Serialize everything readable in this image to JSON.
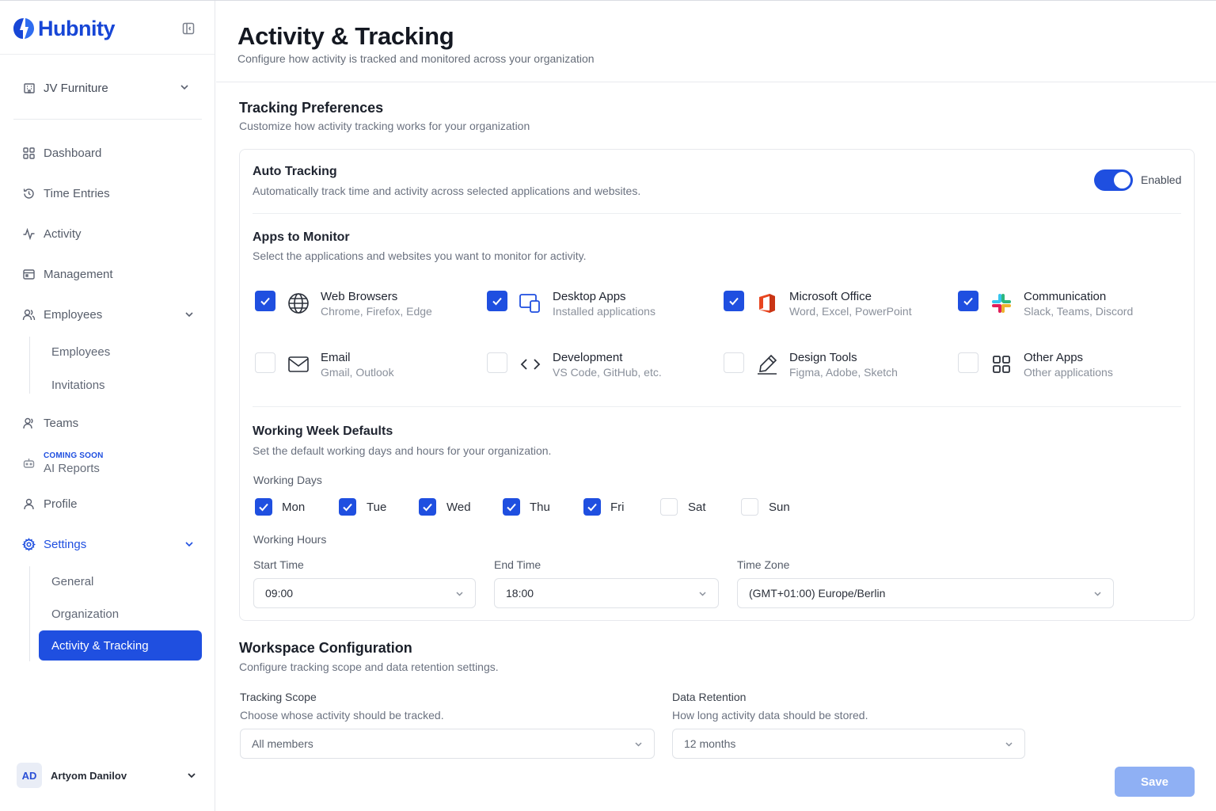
{
  "brand": {
    "name": "Hubnity"
  },
  "org": {
    "name": "JV Furniture"
  },
  "nav": {
    "dashboard": "Dashboard",
    "time_entries": "Time Entries",
    "activity": "Activity",
    "management": "Management",
    "employees": "Employees",
    "employees_sub": [
      "Employees",
      "Invitations"
    ],
    "teams": "Teams",
    "ai_badge": "COMING SOON",
    "ai_reports": "AI Reports",
    "profile": "Profile",
    "settings": "Settings",
    "settings_sub": [
      "General",
      "Organization",
      "Activity & Tracking"
    ]
  },
  "user": {
    "initials": "AD",
    "name": "Artyom Danilov"
  },
  "page": {
    "title": "Activity & Tracking",
    "subtitle": "Configure how activity is tracked and monitored across your organization"
  },
  "tracking": {
    "title": "Tracking Preferences",
    "subtitle": "Customize how activity tracking works for your organization",
    "auto": {
      "title": "Auto Tracking",
      "desc": "Automatically track time and activity across selected applications and websites.",
      "toggle_label": "Enabled",
      "enabled": true
    },
    "apps": {
      "title": "Apps to Monitor",
      "desc": "Select the applications and websites you want to monitor for activity.",
      "items": [
        {
          "name": "Web Browsers",
          "desc": "Chrome, Firefox, Edge",
          "checked": true,
          "icon": "globe-icon"
        },
        {
          "name": "Desktop Apps",
          "desc": "Installed applications",
          "checked": true,
          "icon": "desktop-icon"
        },
        {
          "name": "Microsoft Office",
          "desc": "Word, Excel, PowerPoint",
          "checked": true,
          "icon": "office-icon"
        },
        {
          "name": "Communication",
          "desc": "Slack, Teams, Discord",
          "checked": true,
          "icon": "slack-icon"
        },
        {
          "name": "Email",
          "desc": "Gmail, Outlook",
          "checked": false,
          "icon": "mail-icon"
        },
        {
          "name": "Development",
          "desc": "VS Code, GitHub, etc.",
          "checked": false,
          "icon": "code-icon"
        },
        {
          "name": "Design Tools",
          "desc": "Figma, Adobe, Sketch",
          "checked": false,
          "icon": "pen-icon"
        },
        {
          "name": "Other Apps",
          "desc": "Other applications",
          "checked": false,
          "icon": "grid-icon"
        }
      ]
    },
    "week": {
      "title": "Working Week Defaults",
      "desc": "Set the default working days and hours for your organization.",
      "days_label": "Working Days",
      "days": [
        {
          "label": "Mon",
          "checked": true
        },
        {
          "label": "Tue",
          "checked": true
        },
        {
          "label": "Wed",
          "checked": true
        },
        {
          "label": "Thu",
          "checked": true
        },
        {
          "label": "Fri",
          "checked": true
        },
        {
          "label": "Sat",
          "checked": false
        },
        {
          "label": "Sun",
          "checked": false
        }
      ],
      "hours_label": "Working Hours",
      "start_label": "Start Time",
      "start_value": "09:00",
      "end_label": "End Time",
      "end_value": "18:00",
      "tz_label": "Time Zone",
      "tz_value": "(GMT+01:00) Europe/Berlin"
    }
  },
  "workspace": {
    "title": "Workspace Configuration",
    "subtitle": "Configure tracking scope and data retention settings.",
    "scope_label": "Tracking Scope",
    "scope_desc": "Choose whose activity should be tracked.",
    "scope_value": "All members",
    "retention_label": "Data Retention",
    "retention_desc": "How long activity data should be stored.",
    "retention_value": "12 months"
  },
  "actions": {
    "save": "Save"
  },
  "colors": {
    "accent": "#1f4fe0",
    "brand": "#1746d6",
    "save_disabled": "#8fb0f4"
  }
}
